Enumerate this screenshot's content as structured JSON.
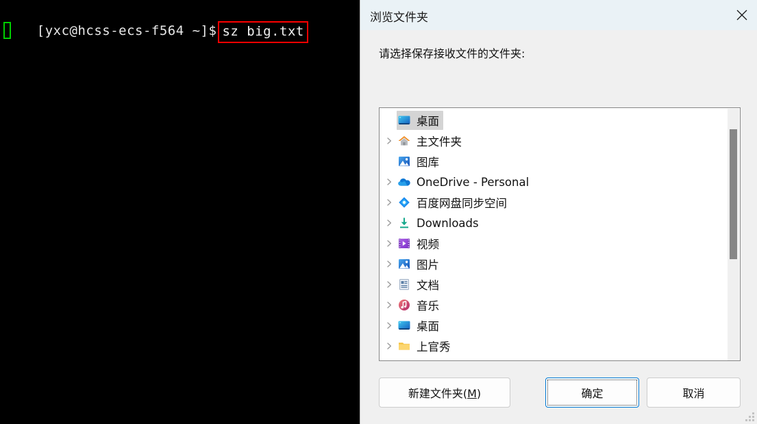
{
  "terminal": {
    "prompt": "[yxc@hcss-ecs-f564 ~]$",
    "command": "sz big.txt",
    "highlight_color": "#ff0000",
    "cursor_color": "#00d000",
    "background": "#000000",
    "foreground": "#e6e6e6"
  },
  "dialog": {
    "title": "浏览文件夹",
    "close_icon": "close-icon",
    "prompt": "请选择保存接收文件的文件夹:",
    "titlebar_color": "#eaf2f6",
    "body_color": "#f0f0f0",
    "tree": {
      "items": [
        {
          "label": "桌面",
          "icon": "monitor-icon",
          "expandable": false,
          "selected": true,
          "indent": 0
        },
        {
          "label": "主文件夹",
          "icon": "home-icon",
          "expandable": true,
          "selected": false,
          "indent": 0
        },
        {
          "label": "图库",
          "icon": "gallery-icon",
          "expandable": false,
          "selected": false,
          "indent": 0
        },
        {
          "label": "OneDrive - Personal",
          "icon": "onedrive-icon",
          "expandable": true,
          "selected": false,
          "indent": 0
        },
        {
          "label": "百度网盘同步空间",
          "icon": "baidu-icon",
          "expandable": true,
          "selected": false,
          "indent": 0
        },
        {
          "label": "Downloads",
          "icon": "download-icon",
          "expandable": true,
          "selected": false,
          "indent": 0
        },
        {
          "label": "视频",
          "icon": "video-icon",
          "expandable": true,
          "selected": false,
          "indent": 0
        },
        {
          "label": "图片",
          "icon": "pictures-icon",
          "expandable": true,
          "selected": false,
          "indent": 0
        },
        {
          "label": "文档",
          "icon": "documents-icon",
          "expandable": true,
          "selected": false,
          "indent": 0
        },
        {
          "label": "音乐",
          "icon": "music-icon",
          "expandable": true,
          "selected": false,
          "indent": 0
        },
        {
          "label": "桌面",
          "icon": "desktop-icon",
          "expandable": true,
          "selected": false,
          "indent": 0
        },
        {
          "label": "上官秀",
          "icon": "folder-icon",
          "expandable": true,
          "selected": false,
          "indent": 0
        }
      ],
      "scrollbar": {
        "thumb_color": "#878787",
        "track_color": "#f0f0f0"
      }
    },
    "buttons": {
      "new_folder": "新建文件夹(M)",
      "new_folder_mnemonic": "M",
      "ok": "确定",
      "cancel": "取消",
      "focused": "ok",
      "focus_color": "#0078d4"
    }
  }
}
